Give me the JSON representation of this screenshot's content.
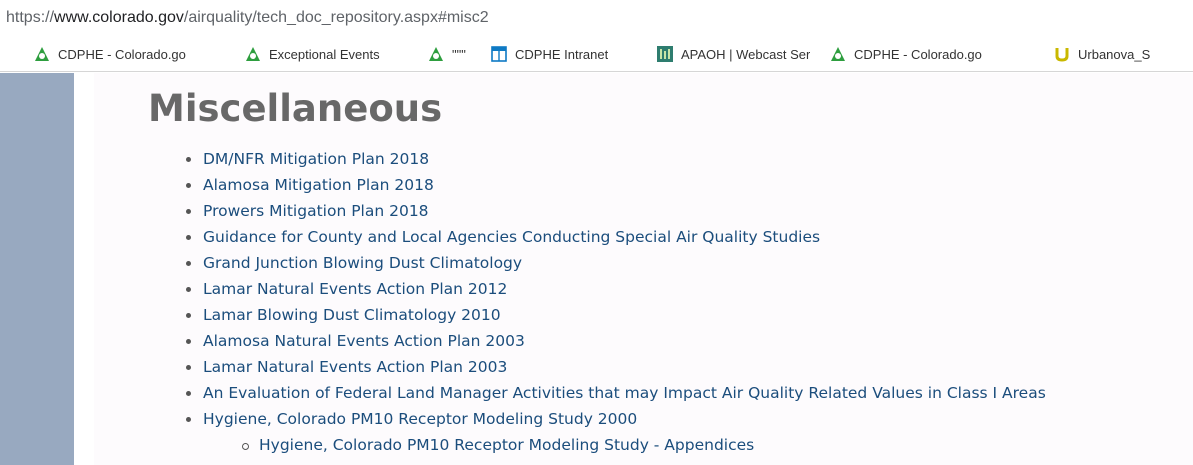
{
  "browser": {
    "url": "https://www.colorado.gov/airquality/tech_doc_repository.aspx#misc2",
    "url_parts": {
      "prefix": "https://",
      "domain": "www.colorado.gov",
      "path": "/airquality/tech_doc_repository.aspx#misc2"
    }
  },
  "bookmarks": [
    {
      "label": "CDPHE - Colorado.go",
      "icon": "cdphe-triangle-icon"
    },
    {
      "label": "Exceptional Events",
      "icon": "cdphe-triangle-icon"
    },
    {
      "label": "\"\"\"",
      "icon": "cdphe-triangle-icon"
    },
    {
      "label": "CDPHE Intranet",
      "icon": "sharepoint-table-icon"
    },
    {
      "label": "APAOH | Webcast Ser",
      "icon": "webcast-icon"
    },
    {
      "label": "CDPHE - Colorado.go",
      "icon": "cdphe-triangle-icon"
    },
    {
      "label": "Urbanova_S",
      "icon": "urbanova-u-icon"
    }
  ],
  "page": {
    "heading": "Miscellaneous",
    "items": [
      "DM/NFR Mitigation Plan 2018",
      "Alamosa Mitigation Plan 2018",
      "Prowers Mitigation Plan 2018",
      "Guidance for County and Local Agencies Conducting Special Air Quality Studies",
      "Grand Junction Blowing Dust Climatology",
      "Lamar Natural Events Action Plan 2012",
      "Lamar Blowing Dust Climatology 2010",
      "Alamosa Natural Events Action Plan 2003",
      "Lamar Natural Events Action Plan 2003",
      "An Evaluation of Federal Land Manager Activities that may Impact Air Quality Related Values in Class I Areas",
      "Hygiene, Colorado PM10 Receptor Modeling Study 2000"
    ],
    "sub_items": [
      "Hygiene, Colorado PM10 Receptor Modeling Study - Appendices"
    ]
  },
  "colors": {
    "link": "#1b4d7c",
    "heading": "#686868",
    "left_bar": "#98a9c0",
    "cdphe_green": "#2e9e3f",
    "urbanova_yellow": "#c9b800"
  }
}
